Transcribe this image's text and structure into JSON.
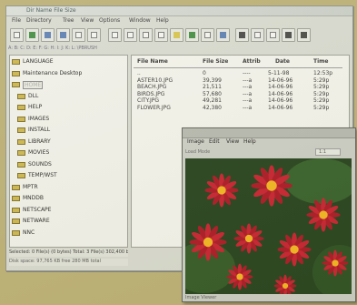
{
  "window": {
    "title": "Dir Name   File Size"
  },
  "menu": [
    "File",
    "Directory",
    "Tree",
    "View",
    "Options",
    "Window",
    "Help"
  ],
  "drive_bar": "A: B: C: D: E: F: G: H: I: J: K: L:  \\PBRUSH",
  "tree": {
    "items": [
      {
        "label": "LANGUAGE",
        "selected": false
      },
      {
        "label": "Maintenance Desktop",
        "selected": false
      },
      {
        "label": "HOME",
        "selected": true
      },
      {
        "label": "DLL",
        "selected": false
      },
      {
        "label": "HELP",
        "selected": false
      },
      {
        "label": "IMAGES",
        "selected": false
      },
      {
        "label": "INSTALL",
        "selected": false
      },
      {
        "label": "LIBRARY",
        "selected": false
      },
      {
        "label": "MOVIES",
        "selected": false
      },
      {
        "label": "SOUNDS",
        "selected": false
      },
      {
        "label": "TEMP/WST",
        "selected": false
      },
      {
        "label": "MPTR",
        "selected": false
      },
      {
        "label": "MNDDB",
        "selected": false
      },
      {
        "label": "NETSCAPE",
        "selected": false
      },
      {
        "label": "NETWARE",
        "selected": false
      },
      {
        "label": "NNC",
        "selected": false
      }
    ]
  },
  "file_list": {
    "headers": [
      "File Name",
      "File Size",
      "Attrib",
      "Date",
      "Time"
    ],
    "rows": [
      {
        "name": "..",
        "size": "0",
        "attr": "----",
        "date": "5-11-98",
        "time": "12:53p"
      },
      {
        "name": "ASTER10.JPG",
        "size": "39,399",
        "attr": "---a",
        "date": "14-06-96",
        "time": "5:29p"
      },
      {
        "name": "BEACH.JPG",
        "size": "21,511",
        "attr": "---a",
        "date": "14-06-96",
        "time": "5:29p"
      },
      {
        "name": "BIRDS.JPG",
        "size": "57,680",
        "attr": "---a",
        "date": "14-06-96",
        "time": "5:29p"
      },
      {
        "name": "CITY.JPG",
        "size": "49,281",
        "attr": "---a",
        "date": "14-06-96",
        "time": "5:29p"
      },
      {
        "name": "FLOWER.JPG",
        "size": "42,380",
        "attr": "---a",
        "date": "14-06-96",
        "time": "5:29p"
      }
    ]
  },
  "status": {
    "line1": "Selected: 0 File(s) (0 bytes) Total: 3 File(s) 302,400 bytes",
    "line2": "Disk space: 97,765 KB free  280 MB total"
  },
  "viewer": {
    "menu": [
      "Image",
      "Edit",
      "View",
      "Help"
    ],
    "info": "Load Mode",
    "zoom": "1:1",
    "status": "Image Viewer"
  }
}
